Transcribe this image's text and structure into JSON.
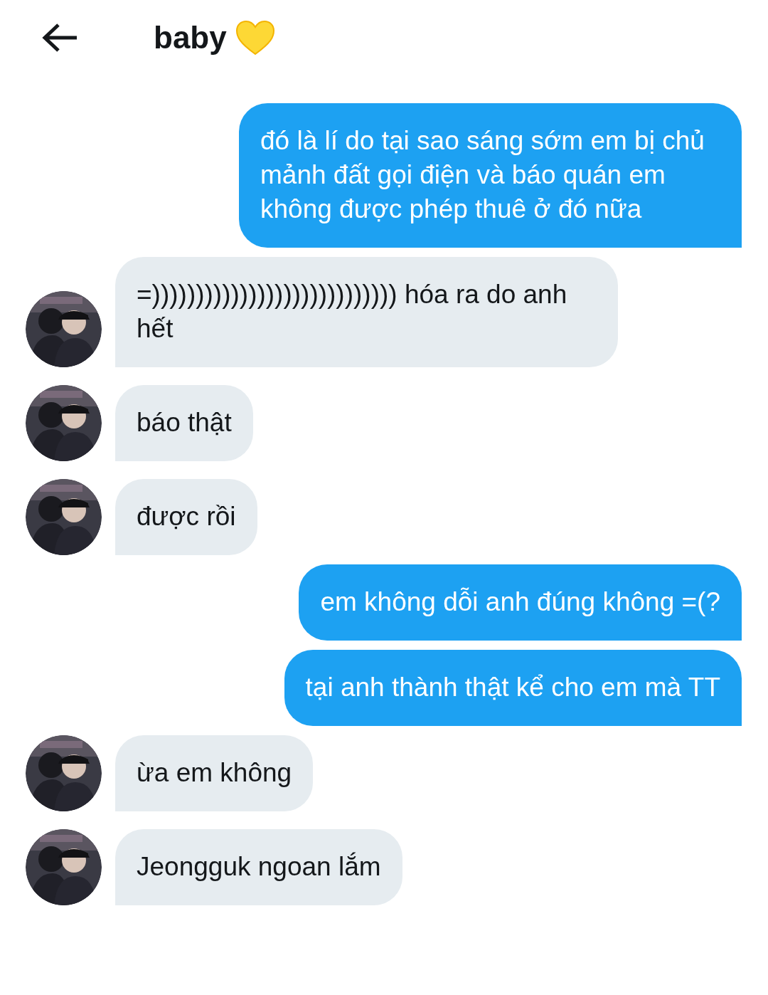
{
  "header": {
    "title": "baby"
  },
  "messages": [
    {
      "kind": "sent",
      "text": "đó là lí do tại sao sáng sớm em bị chủ mảnh đất gọi điện và báo quán em không được phép thuê ở đó nữa"
    },
    {
      "kind": "received",
      "text": "=)))))))))))))))))))))))))))) hóa ra do anh hết"
    },
    {
      "kind": "received",
      "text": "báo thật"
    },
    {
      "kind": "received",
      "text": "được rồi"
    },
    {
      "kind": "sent",
      "text": "em không dỗi anh đúng không =(?"
    },
    {
      "kind": "sent",
      "text": "tại anh thành thật kể cho em mà TT"
    },
    {
      "kind": "received",
      "text": "ừa em không"
    },
    {
      "kind": "received",
      "text": "Jeongguk ngoan lắm"
    }
  ]
}
